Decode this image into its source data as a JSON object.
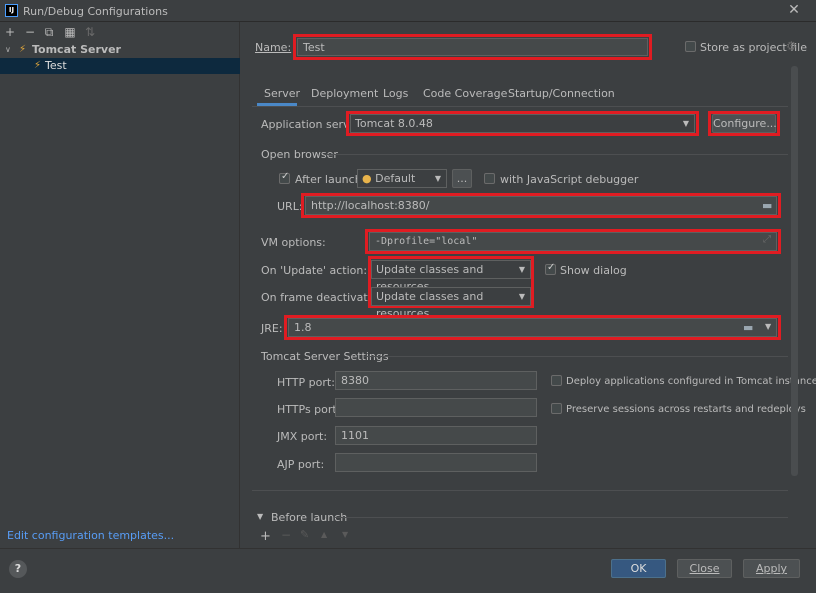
{
  "window": {
    "title": "Run/Debug Configurations"
  },
  "left": {
    "toolbar_icons": [
      "add-icon",
      "remove-icon",
      "copy-icon",
      "move-to-folder-icon",
      "sort-icon"
    ],
    "tree": [
      {
        "label": "Tomcat Server",
        "expanded": true
      },
      {
        "label": "Test",
        "selected": true
      }
    ],
    "edit_templates": "Edit configuration templates..."
  },
  "form": {
    "name_label": "Name:",
    "name_value": "Test",
    "store_label": "Store as project file",
    "tabs": [
      "Server",
      "Deployment",
      "Logs",
      "Code Coverage",
      "Startup/Connection"
    ],
    "app_server_label": "Application server:",
    "app_server_value": "Tomcat 8.0.48",
    "configure_label": "Configure...",
    "open_browser_label": "Open browser",
    "after_launch_label": "After launch",
    "browser_value": "Default",
    "browse_btn": "...",
    "js_debugger_label": "with JavaScript debugger",
    "url_label": "URL:",
    "url_value": "http://localhost:8380/",
    "vm_label": "VM options:",
    "vm_value": "-Dprofile=\"local\"",
    "on_update_label": "On 'Update' action:",
    "on_update_value": "Update classes and resources",
    "show_dialog_label": "Show dialog",
    "on_frame_label": "On frame deactivation:",
    "on_frame_value": "Update classes and resources",
    "jre_label": "JRE:",
    "jre_value": "1.8",
    "tomcat_settings_label": "Tomcat Server Settings",
    "http_label": "HTTP port:",
    "http_value": "8380",
    "https_label": "HTTPs port:",
    "https_value": "",
    "jmx_label": "JMX port:",
    "jmx_value": "1101",
    "ajp_label": "AJP port:",
    "ajp_value": "",
    "deploy_label": "Deploy applications configured in Tomcat instance",
    "preserve_label": "Preserve sessions across restarts and redeploys",
    "before_launch_label": "Before launch"
  },
  "buttons": {
    "ok": "OK",
    "close": "Close",
    "apply": "Apply",
    "help": "?"
  },
  "colors": {
    "highlight_box": "#e01c22",
    "accent": "#4a88c7",
    "ok_button": "#365880"
  }
}
